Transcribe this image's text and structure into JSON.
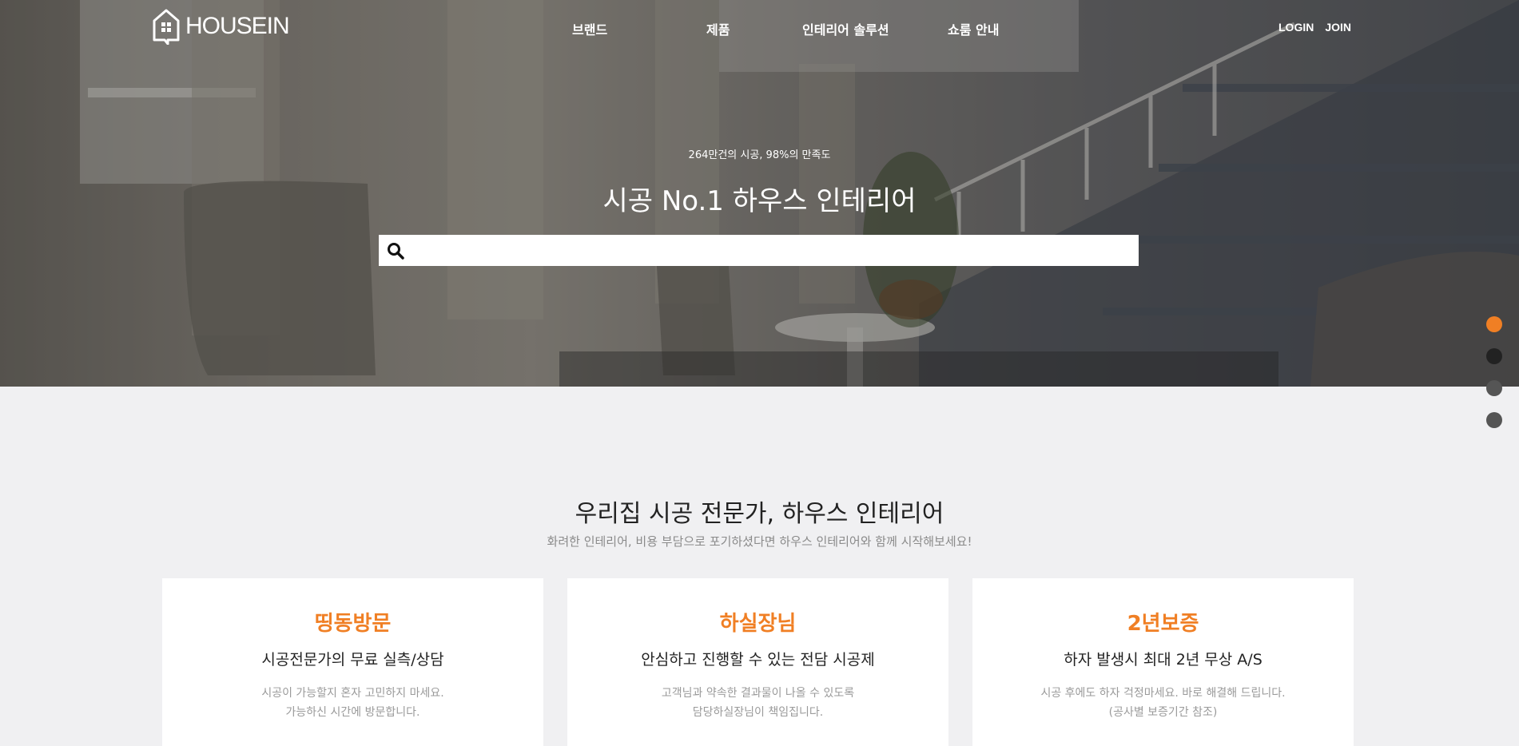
{
  "header": {
    "logo_text": "HOUSEIN",
    "nav": [
      "브랜드",
      "제품",
      "인테리어 솔루션",
      "쇼룸 안내"
    ],
    "login": "LOGIN",
    "join": "JOIN"
  },
  "hero": {
    "subtitle": "264만건의 시공, 98%의 만족도",
    "title": "시공 No.1 하우스 인테리어",
    "search_placeholder": ""
  },
  "slider": {
    "dot_colors": [
      "#f07f24",
      "#222222",
      "#555555",
      "#555555"
    ],
    "active_index": 0
  },
  "intro": {
    "title": "우리집 시공 전문가, 하우스 인테리어",
    "subtitle": "화려한 인테리어, 비용 부담으로 포기하셨다면 하우스 인테리어와 함께 시작해보세요!"
  },
  "cards": [
    {
      "title": "띵동방문",
      "subtitle": "시공전문가의 무료 실측/상담",
      "desc1": "시공이 가능할지 혼자 고민하지 마세요.",
      "desc2": "가능하신 시간에 방문합니다."
    },
    {
      "title": "하실장님",
      "subtitle": "안심하고 진행할 수 있는 전담 시공제",
      "desc1": "고객님과 약속한 결과물이 나올 수 있도록",
      "desc2": "담당하실장님이 책임집니다."
    },
    {
      "title": "2년보증",
      "subtitle": "하자 발생시 최대 2년 무상 A/S",
      "desc1": "시공 후에도 하자 걱정마세요. 바로 해결해 드립니다.",
      "desc2": "(공사별 보증기간 참조)"
    }
  ],
  "colors": {
    "accent": "#f07f24"
  }
}
